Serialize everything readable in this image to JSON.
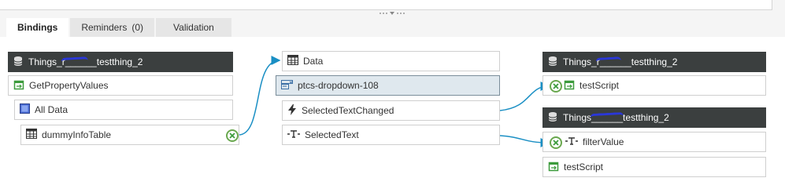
{
  "tabs": [
    {
      "label": "Bindings"
    },
    {
      "label": "Reminders",
      "count": "(0)"
    },
    {
      "label": "Validation"
    }
  ],
  "left": {
    "thing_header": "Things_r______testthing_2",
    "service": "GetPropertyValues",
    "all_data": "All Data",
    "infotable": "dummyInfoTable"
  },
  "middle": {
    "data": "Data",
    "widget": "ptcs-dropdown-108",
    "event": "SelectedTextChanged",
    "property": "SelectedText"
  },
  "right": {
    "thing_header_1": "Things_r______testthing_2",
    "service_1": "testScript",
    "thing_header_2": "Things______testthing_2",
    "param": "filterValue",
    "service_2": "testScript"
  },
  "colors": {
    "header_bg": "#3b3f3f",
    "selected_bg": "#dfe8ee",
    "wire": "#1a8fc4",
    "unbind_green": "#6aa84f",
    "service_green": "#3c9b3c"
  }
}
